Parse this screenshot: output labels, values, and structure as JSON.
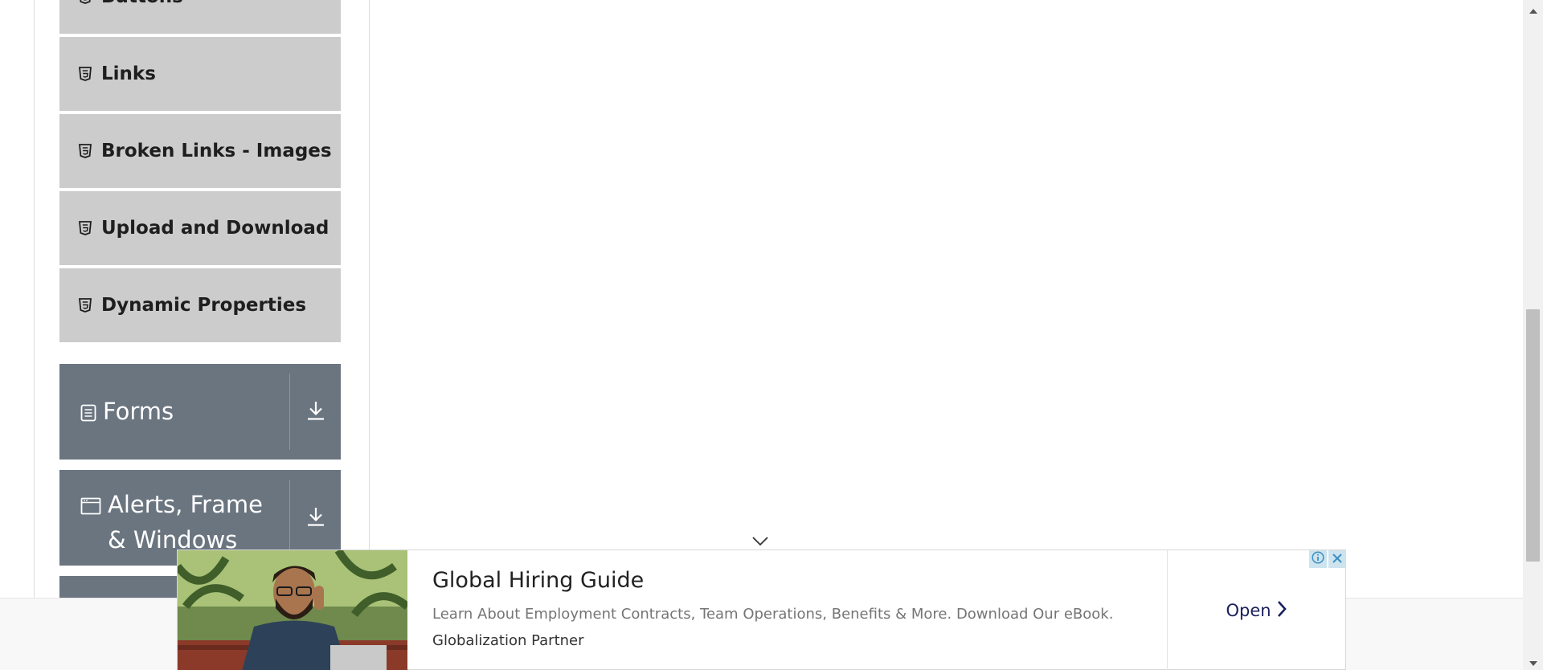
{
  "sidebar": {
    "items": [
      {
        "label": "Buttons",
        "icon": "html5-icon"
      },
      {
        "label": "Links",
        "icon": "html5-icon"
      },
      {
        "label": "Broken Links - Images",
        "icon": "html5-icon"
      },
      {
        "label": "Upload and Download",
        "icon": "html5-icon"
      },
      {
        "label": "Dynamic Properties",
        "icon": "html5-icon"
      }
    ],
    "groups": [
      {
        "label": "Forms",
        "icon": "document-icon",
        "action_icon": "download-icon"
      },
      {
        "label": "Alerts, Frame & Windows",
        "icon": "window-icon",
        "action_icon": "download-icon"
      }
    ]
  },
  "ad": {
    "title": "Global Hiring Guide",
    "description": "Learn About Employment Contracts, Team Operations, Benefits & More. Download Our eBook.",
    "source": "Globalization Partner",
    "cta_label": "Open"
  },
  "colors": {
    "menu_item_bg": "#cccccc",
    "group_header_bg": "#6b7580",
    "ad_cta": "#1a1f5c",
    "ad_badge_bg": "#cde4ef",
    "ad_badge_fg": "#3c8fc4"
  }
}
